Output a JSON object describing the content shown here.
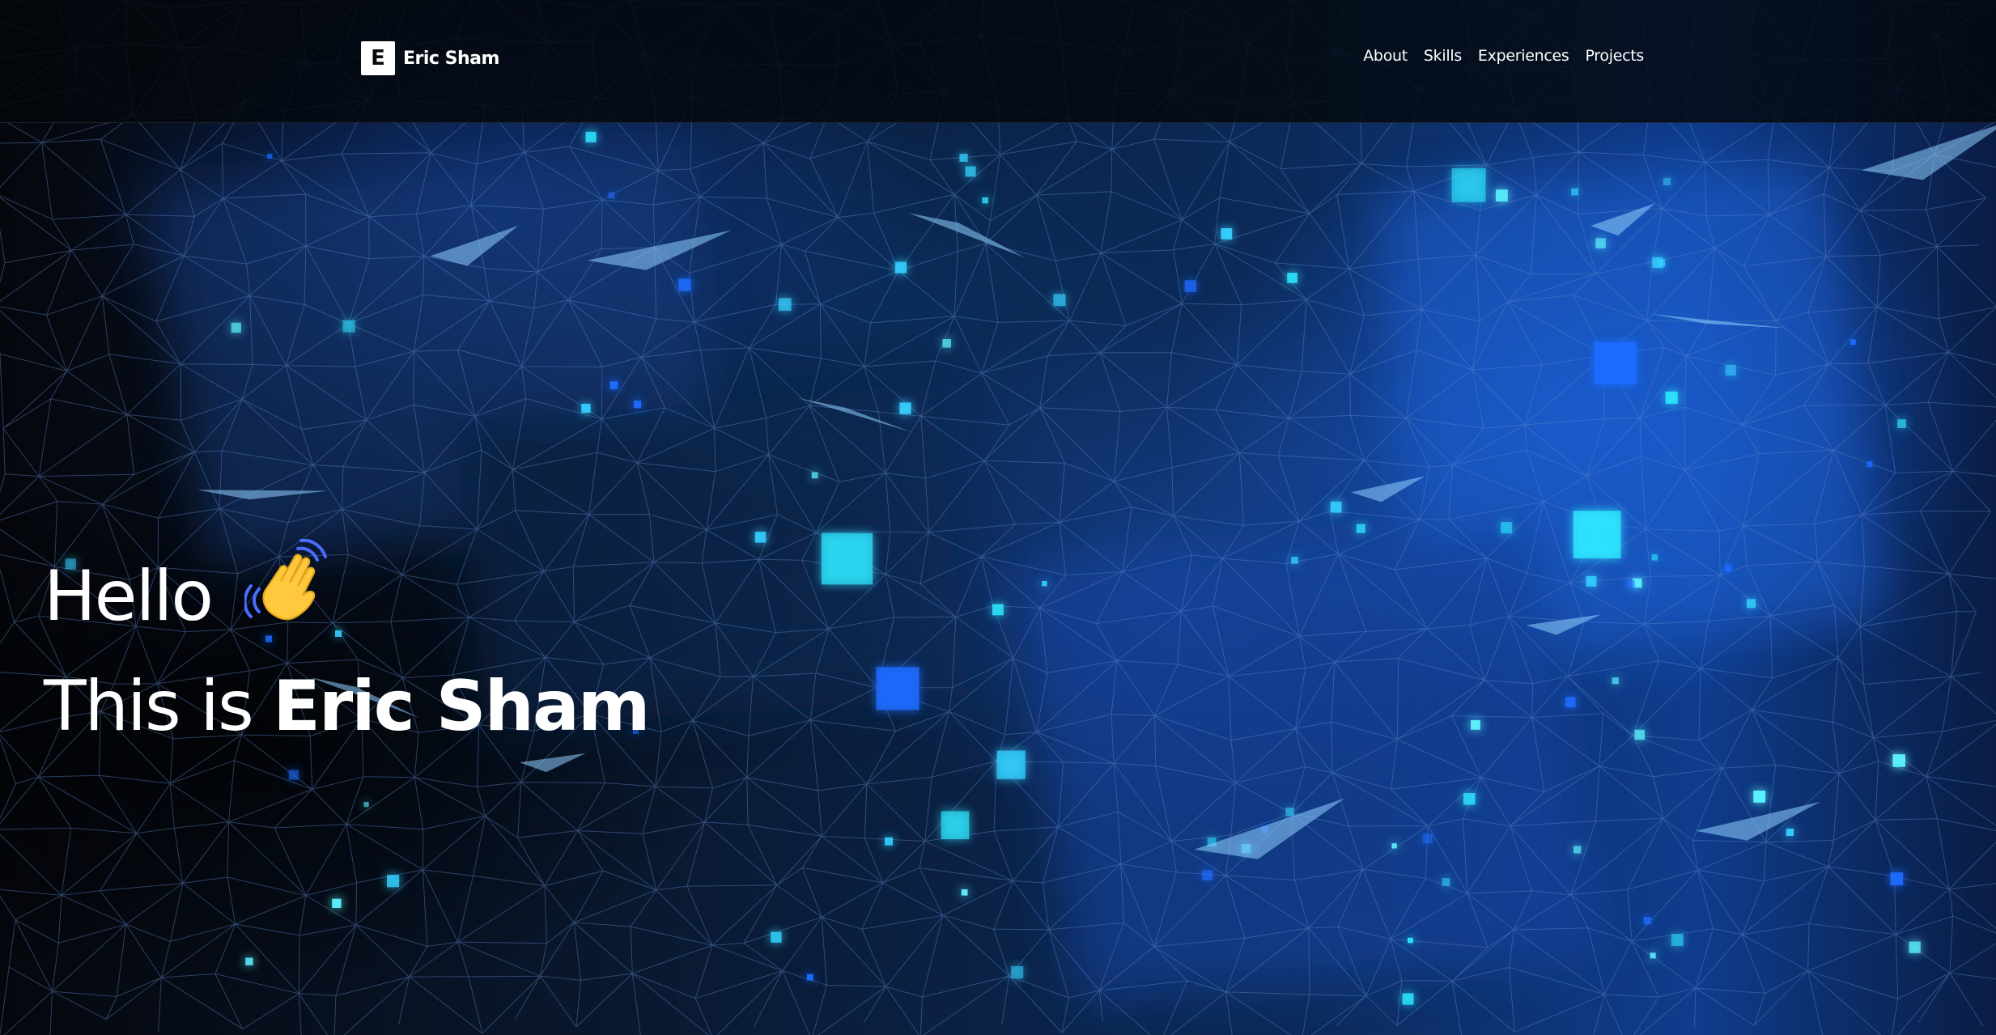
{
  "navbar": {
    "brand_letter": "E",
    "brand_name": "Eric Sham",
    "links": [
      "About",
      "Skills",
      "Experiences",
      "Projects"
    ]
  },
  "hero": {
    "greeting": "Hello",
    "intro": "This is ",
    "name": "Eric Sham",
    "wave_icon": "waving-hand-icon"
  },
  "colors": {
    "background": "#05080f",
    "accent_blue": "#1e6bff",
    "accent_cyan": "#2ee6ff",
    "text": "#ffffff",
    "wave_yellow": "#ffc83d"
  }
}
